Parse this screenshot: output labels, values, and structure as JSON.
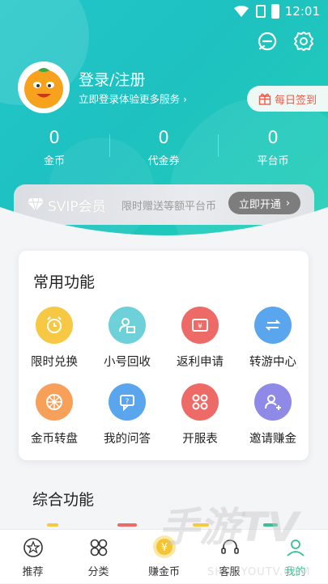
{
  "status_bar": {
    "time": "12:01"
  },
  "profile": {
    "login_title": "登录/注册",
    "login_subtitle": "立即登录体验更多服务",
    "checkin_label": "每日签到"
  },
  "stats": [
    {
      "value": "0",
      "label": "金币"
    },
    {
      "value": "0",
      "label": "代金券"
    },
    {
      "value": "0",
      "label": "平台币"
    }
  ],
  "svip": {
    "title": "SVIP会员",
    "desc": "限时赠送等额平台币",
    "button": "立即开通"
  },
  "common_features": {
    "title": "常用功能",
    "items": [
      {
        "label": "限时兑换",
        "icon": "alarm-clock-icon",
        "color": "#f7c843"
      },
      {
        "label": "小号回收",
        "icon": "user-recycle-icon",
        "color": "#6ed0d8"
      },
      {
        "label": "返利申请",
        "icon": "rebate-ticket-icon",
        "color": "#ee6a66"
      },
      {
        "label": "转游中心",
        "icon": "transfer-icon",
        "color": "#5aa6ee"
      },
      {
        "label": "金币转盘",
        "icon": "wheel-icon",
        "color": "#f6a05a"
      },
      {
        "label": "我的问答",
        "icon": "qa-icon",
        "color": "#5aa6ee"
      },
      {
        "label": "开服表",
        "icon": "grid-icon",
        "color": "#ee6a66"
      },
      {
        "label": "邀请赚金",
        "icon": "invite-icon",
        "color": "#8f8ae8"
      }
    ]
  },
  "section2": {
    "title": "综合功能"
  },
  "tabbar": [
    {
      "label": "推荐",
      "icon": "star-icon"
    },
    {
      "label": "分类",
      "icon": "category-icon"
    },
    {
      "label": "赚金币",
      "icon": "coin-icon"
    },
    {
      "label": "客服",
      "icon": "headset-icon"
    },
    {
      "label": "我的",
      "icon": "profile-icon",
      "active": true
    }
  ],
  "watermark": {
    "text": "手游TV",
    "subtext": "SHOUYOUTV.COM"
  },
  "colors": {
    "accent": "#1ec6c2",
    "tab_active": "#3bbf8f",
    "checkin_text": "#e85d4e"
  }
}
